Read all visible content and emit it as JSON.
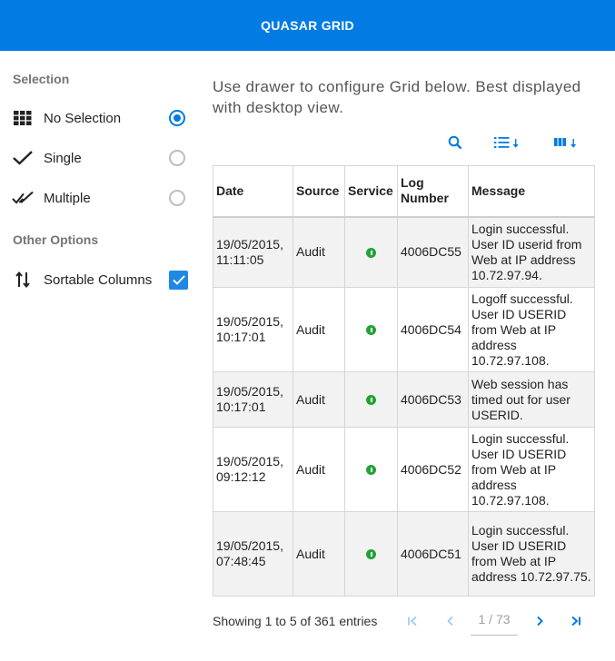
{
  "header": {
    "title": "QUASAR GRID"
  },
  "drawer": {
    "selection_title": "Selection",
    "selection_options": [
      {
        "label": "No Selection",
        "icon": "grid-icon",
        "selected": true
      },
      {
        "label": "Single",
        "icon": "check-icon",
        "selected": false
      },
      {
        "label": "Multiple",
        "icon": "double-check-icon",
        "selected": false
      }
    ],
    "other_title": "Other Options",
    "sortable": {
      "label": "Sortable Columns",
      "icon": "sort-arrows-icon",
      "checked": true
    }
  },
  "main": {
    "intro": "Use drawer to configure Grid below. Best displayed with desktop view.",
    "toolbar": {
      "search_icon": "search-icon",
      "rows_icon": "rows-per-page-icon",
      "columns_icon": "columns-icon"
    }
  },
  "table": {
    "headers": [
      "Date",
      "Source",
      "Service",
      "Log Number",
      "Message"
    ],
    "rows": [
      {
        "date": "19/05/2015, 11:11:05",
        "source": "Audit",
        "log": "4006DC55",
        "message": "Login successful. User ID userid from Web at IP address 10.72.97.94."
      },
      {
        "date": "19/05/2015, 10:17:01",
        "source": "Audit",
        "log": "4006DC54",
        "message": "Logoff successful. User ID USERID from Web at IP address 10.72.97.108."
      },
      {
        "date": "19/05/2015, 10:17:01",
        "source": "Audit",
        "log": "4006DC53",
        "message": "Web session has timed out for user USERID."
      },
      {
        "date": "19/05/2015, 09:12:12",
        "source": "Audit",
        "log": "4006DC52",
        "message": "Login successful. User ID USERID from Web at IP address 10.72.97.108."
      },
      {
        "date": "19/05/2015, 07:48:45",
        "source": "Audit",
        "log": "4006DC51",
        "message": "Login successful. User ID USERID from Web at IP address 10.72.97.75."
      }
    ]
  },
  "footer": {
    "showing": "Showing 1 to 5 of 361 entries",
    "page": "1 / 73",
    "first": "|<",
    "prev": "<",
    "next": ">",
    "last": ">|"
  },
  "colors": {
    "primary": "#027be3",
    "service_ok": "#21a336"
  }
}
